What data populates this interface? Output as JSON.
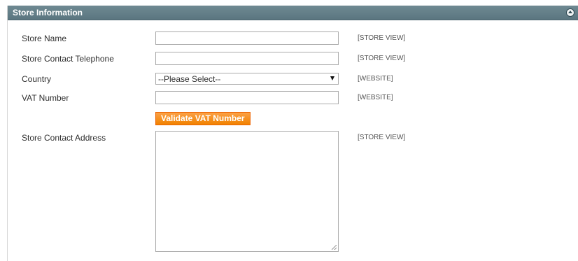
{
  "section": {
    "title": "Store Information"
  },
  "fields": {
    "store_name": {
      "label": "Store Name",
      "value": "",
      "scope": "[STORE VIEW]"
    },
    "telephone": {
      "label": "Store Contact Telephone",
      "value": "",
      "scope": "[STORE VIEW]"
    },
    "country": {
      "label": "Country",
      "selected": "--Please Select--",
      "scope": "[WEBSITE]"
    },
    "vat": {
      "label": "VAT Number",
      "value": "",
      "scope": "[WEBSITE]"
    },
    "validate_button": "Validate VAT Number",
    "address": {
      "label": "Store Contact Address",
      "value": "",
      "scope": "[STORE VIEW]"
    }
  },
  "colors": {
    "header": "#5f7a84",
    "button": "#f18200"
  },
  "icons": {
    "collapse": "chevron-up-icon",
    "select": "dropdown-arrow-icon",
    "resize": "resize-grip-icon"
  }
}
